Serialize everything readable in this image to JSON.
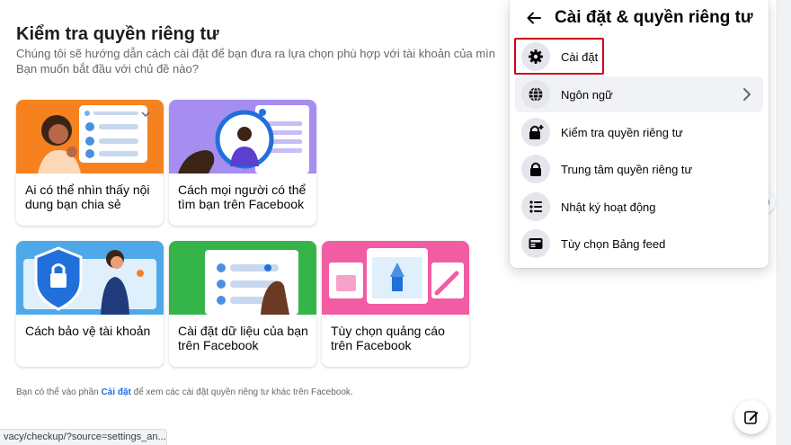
{
  "page": {
    "title": "Kiểm tra quyền riêng tư",
    "description_line1": "Chúng tôi sẽ hướng dẫn cách cài đặt để bạn đưa ra lựa chọn phù hợp với tài khoản của mìn",
    "description_line2": "Bạn muốn bắt đầu với chủ đề nào?"
  },
  "cards": [
    {
      "label": "Ai có thể nhìn thấy nội dung bạn chia sẻ",
      "color": "#f5821f"
    },
    {
      "label": "Cách mọi người có thể tìm bạn trên Facebook",
      "color": "#a58ef0"
    },
    {
      "label": "Cách bảo vệ tài khoản",
      "color": "#4fa8e8"
    },
    {
      "label": "Cài đặt dữ liệu của bạn trên Facebook",
      "color": "#35b449"
    },
    {
      "label": "Tùy chọn quảng cáo trên Facebook",
      "color": "#f25ca2"
    }
  ],
  "footer": {
    "prefix": "Bạn có thể vào phần",
    "link": "Cài đặt",
    "suffix": "để xem các cài đặt quyền riêng tư khác trên Facebook."
  },
  "status_url": "vacy/checkup/?source=settings_an...",
  "panel": {
    "title": "Cài đặt & quyền riêng tư",
    "items": [
      {
        "label": "Cài đặt",
        "icon": "gear-icon"
      },
      {
        "label": "Ngôn ngữ",
        "icon": "globe-icon"
      },
      {
        "label": "Kiểm tra quyền riêng tư",
        "icon": "lock-plus-icon"
      },
      {
        "label": "Trung tâm quyền riêng tư",
        "icon": "lock-icon"
      },
      {
        "label": "Nhật ký hoạt động",
        "icon": "list-icon"
      },
      {
        "label": "Tùy chọn Bảng feed",
        "icon": "feed-icon"
      }
    ]
  },
  "colors": {
    "accent": "#216fdb",
    "highlight": "#d0021b"
  }
}
